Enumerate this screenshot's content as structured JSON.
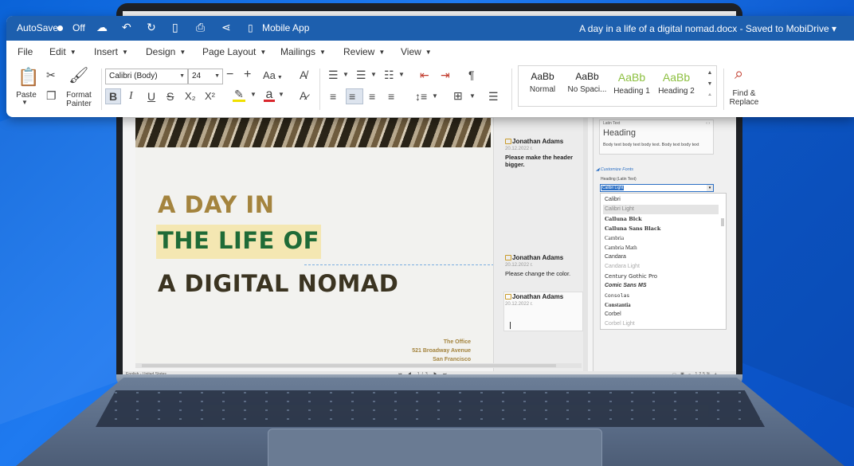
{
  "titlebar": {
    "autosave_label": "AutoSave",
    "autosave_state": "Off",
    "mobile_app_label": "Mobile App",
    "doc_title": "A day in a life of a digital nomad.docx - Saved to MobiDrive",
    "title_caret": "▾"
  },
  "menu": {
    "file": "File",
    "edit": "Edit",
    "insert": "Insert",
    "design": "Design",
    "page_layout": "Page Layout",
    "mailings": "Mailings",
    "review": "Review",
    "view": "View"
  },
  "toolbar": {
    "paste_label": "Paste",
    "format_painter_label": "Format\nPainter",
    "font_name": "Calibri (Body)",
    "font_size": "24",
    "change_case_label": "Aa",
    "bold": "B",
    "italic": "I",
    "underline": "U",
    "strike": "S",
    "subscript": "X₂",
    "superscript": "X²",
    "font_color_letter": "a",
    "find_replace_label": "Find &\nReplace"
  },
  "styles": [
    {
      "sample": "AaBb",
      "name": "Normal"
    },
    {
      "sample": "AaBb",
      "name": "No Spaci..."
    },
    {
      "sample": "AaBb",
      "name": "Heading 1"
    },
    {
      "sample": "AaBb",
      "name": "Heading 2"
    }
  ],
  "document": {
    "headline_1": "A DAY IN",
    "headline_2": "THE LIFE OF",
    "headline_3": "A DIGITAL NOMAD",
    "address": [
      "The Office",
      "521 Broadway Avenue",
      "San Francisco"
    ]
  },
  "comments": [
    {
      "author": "Jonathan Adams",
      "date": "20.12.2022 г.",
      "text": "Please make the header bigger."
    },
    {
      "author": "Jonathan Adams",
      "date": "20.12.2022 г.",
      "text": "Please change the color."
    },
    {
      "author": "Jonathan Adams",
      "date": "20.12.2022 г.",
      "text": ""
    }
  ],
  "side_panel": {
    "theme_label": "Latin Text",
    "heading_sample": "Heading",
    "body_sample": "Body text body text body text. Body text body text",
    "customize_fonts": "Customize Fonts",
    "heading_latin_label": "Heading (Latin Text)",
    "selected_font": "Calibri Light",
    "fonts": [
      "Calibri",
      "Calibri Light",
      "Calluna Blck",
      "Calluna Sans Black",
      "Cambria",
      "Cambria Math",
      "Candara",
      "Candara Light",
      "Century Gothic Pro",
      "Comic Sans MS",
      "Consolas",
      "Constantia",
      "Corbel",
      "Corbel Light"
    ]
  },
  "statusbar": {
    "language": "English - United States",
    "page": "1/3",
    "zoom": "125%"
  },
  "colors": {
    "titlebar": "#1d5fae",
    "headline_gold": "#a4843e",
    "headline_green": "#1f6b37",
    "highlight": "#f4e7b2",
    "heading_style_green": "#8cbf3f",
    "font_color_underline": "#d9262c",
    "highlight_pen": "#f0e000"
  },
  "icons": {
    "cloud": "cloud-icon",
    "undo": "undo-icon",
    "redo": "redo-icon",
    "new_doc": "new-document-icon",
    "print": "print-icon",
    "share": "share-icon",
    "phone": "phone-icon"
  }
}
